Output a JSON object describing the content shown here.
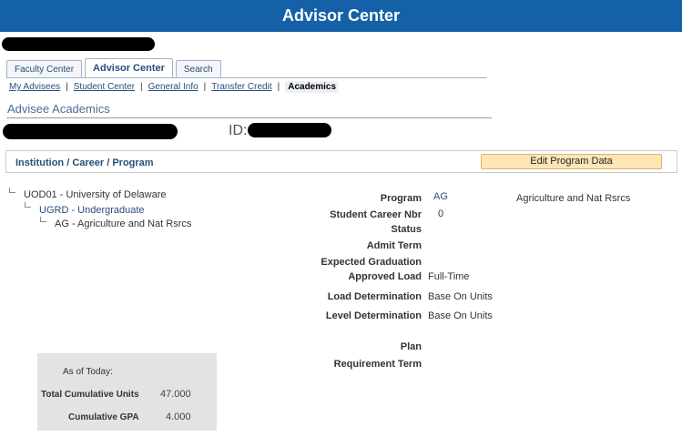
{
  "header": {
    "title": "Advisor Center"
  },
  "tabs": [
    {
      "label": "Faculty Center",
      "active": false
    },
    {
      "label": "Advisor Center",
      "active": true
    },
    {
      "label": "Search",
      "active": false
    }
  ],
  "subnav": {
    "links": [
      "My Advisees",
      "Student Center",
      "General Info",
      "Transfer Credit"
    ],
    "current": "Academics",
    "separator": "|"
  },
  "page": {
    "section_title": "Advisee Academics",
    "id_label": "ID:"
  },
  "institution_bar": {
    "label": "Institution / Career / Program",
    "edit_button": "Edit Program Data"
  },
  "tree": {
    "institution": "UOD01 - University of Delaware",
    "career": "UGRD - Undergraduate",
    "program": "AG - Agriculture and Nat Rsrcs"
  },
  "details": {
    "program_label": "Program",
    "program_value": "AG",
    "program_description": "Agriculture and Nat Rsrcs",
    "career_nbr_label": "Student Career Nbr",
    "career_nbr_value": "0",
    "status_label": "Status",
    "admit_term_label": "Admit Term",
    "expected_grad_label": "Expected Graduation",
    "approved_load_label": "Approved Load",
    "approved_load_value": "Full-Time",
    "load_det_label": "Load Determination",
    "load_det_value": "Base On Units",
    "level_det_label": "Level Determination",
    "level_det_value": "Base On Units",
    "plan_label": "Plan",
    "req_term_label": "Requirement Term"
  },
  "totals": {
    "as_of": "As of Today:",
    "units_label": "Total Cumulative Units",
    "units_value": "47.000",
    "gpa_label": "Cumulative GPA",
    "gpa_value": "4.000"
  },
  "colors": {
    "banner": "#1561a8",
    "link": "#284e7b",
    "button": "#fde5b6",
    "totals_bg": "#e3e3e3"
  }
}
